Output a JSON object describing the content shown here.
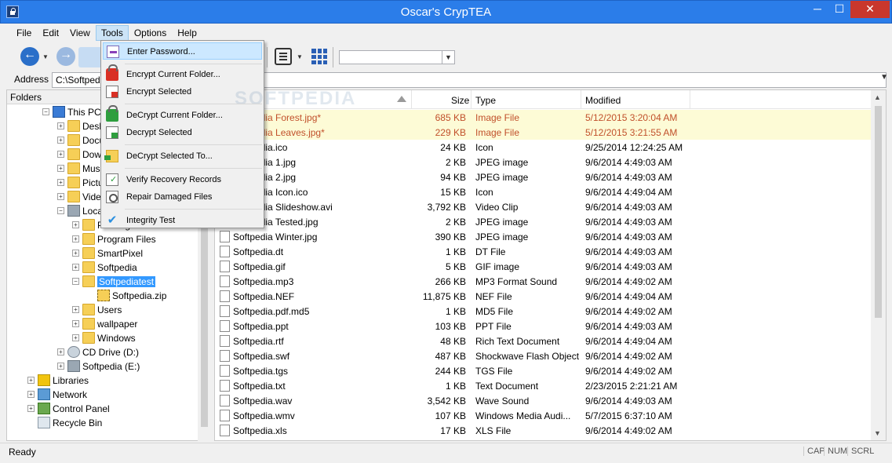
{
  "window": {
    "title": "Oscar's CrypTEA",
    "min": "─",
    "max": "☐",
    "close": "✕"
  },
  "menu": [
    "File",
    "Edit",
    "View",
    "Tools",
    "Options",
    "Help"
  ],
  "address": {
    "label": "Address",
    "value": "C:\\Softpedia"
  },
  "watermark": "SOFTPEDIA",
  "folders": {
    "title": "Folders",
    "items": [
      {
        "label": "This PC",
        "icon": "pc-icon",
        "expander": "−"
      },
      {
        "label": "Desktop",
        "icon": "folder-icon",
        "expander": "+"
      },
      {
        "label": "Documents",
        "icon": "folder-icon",
        "expander": "+"
      },
      {
        "label": "Downloads",
        "icon": "folder-icon",
        "expander": "+"
      },
      {
        "label": "Music",
        "icon": "folder-icon",
        "expander": "+"
      },
      {
        "label": "Pictures",
        "icon": "folder-icon",
        "expander": "+"
      },
      {
        "label": "Videos",
        "icon": "folder-icon",
        "expander": "+"
      },
      {
        "label": "Local Disk (C:)",
        "icon": "drive-icon",
        "expander": "−"
      },
      {
        "label": "PerfLogs",
        "icon": "folder-icon",
        "expander": "+"
      },
      {
        "label": "Program Files",
        "icon": "folder-icon",
        "expander": "+"
      },
      {
        "label": "SmartPixel",
        "icon": "folder-icon",
        "expander": "+"
      },
      {
        "label": "Softpedia",
        "icon": "folder-icon",
        "expander": "+"
      },
      {
        "label": "Softpediatest",
        "icon": "folder-icon",
        "expander": "−"
      },
      {
        "label": "Softpedia.zip",
        "icon": "zip-icon",
        "expander": ""
      },
      {
        "label": "Users",
        "icon": "folder-icon",
        "expander": "+"
      },
      {
        "label": "wallpaper",
        "icon": "folder-icon",
        "expander": "+"
      },
      {
        "label": "Windows",
        "icon": "folder-icon",
        "expander": "+"
      },
      {
        "label": "CD Drive (D:)",
        "icon": "cd-icon",
        "expander": "+"
      },
      {
        "label": "Softpedia (E:)",
        "icon": "drive-icon",
        "expander": "+"
      },
      {
        "label": "Libraries",
        "icon": "library-icon",
        "expander": "+"
      },
      {
        "label": "Network",
        "icon": "network-icon",
        "expander": "+"
      },
      {
        "label": "Control Panel",
        "icon": "control-panel-icon",
        "expander": "+"
      },
      {
        "label": "Recycle Bin",
        "icon": "recycle-bin-icon",
        "expander": ""
      }
    ]
  },
  "files": {
    "columns": {
      "name": "",
      "size": "Size",
      "type": "Type",
      "modified": "Modified"
    },
    "rows": [
      {
        "name": "Softpedia Forest.jpg*",
        "size": "685 KB",
        "type": "Image File",
        "modified": "5/12/2015 3:20:04 AM"
      },
      {
        "name": "Softpedia Leaves.jpg*",
        "size": "229 KB",
        "type": "Image File",
        "modified": "5/12/2015 3:21:55 AM"
      },
      {
        "name": "Softpedia.ico",
        "size": "24 KB",
        "type": "Icon",
        "modified": "9/25/2014 12:24:25 AM"
      },
      {
        "name": "Softpedia 1.jpg",
        "size": "2 KB",
        "type": "JPEG image",
        "modified": "9/6/2014 4:49:03 AM"
      },
      {
        "name": "Softpedia 2.jpg",
        "size": "94 KB",
        "type": "JPEG image",
        "modified": "9/6/2014 4:49:03 AM"
      },
      {
        "name": "Softpedia Icon.ico",
        "size": "15 KB",
        "type": "Icon",
        "modified": "9/6/2014 4:49:04 AM"
      },
      {
        "name": "Softpedia Slideshow.avi",
        "size": "3,792 KB",
        "type": "Video Clip",
        "modified": "9/6/2014 4:49:03 AM"
      },
      {
        "name": "Softpedia Tested.jpg",
        "size": "2 KB",
        "type": "JPEG image",
        "modified": "9/6/2014 4:49:03 AM"
      },
      {
        "name": "Softpedia Winter.jpg",
        "size": "390 KB",
        "type": "JPEG image",
        "modified": "9/6/2014 4:49:03 AM"
      },
      {
        "name": "Softpedia.dt",
        "size": "1 KB",
        "type": "DT File",
        "modified": "9/6/2014 4:49:03 AM"
      },
      {
        "name": "Softpedia.gif",
        "size": "5 KB",
        "type": "GIF image",
        "modified": "9/6/2014 4:49:03 AM"
      },
      {
        "name": "Softpedia.mp3",
        "size": "266 KB",
        "type": "MP3 Format Sound",
        "modified": "9/6/2014 4:49:02 AM"
      },
      {
        "name": "Softpedia.NEF",
        "size": "11,875 KB",
        "type": "NEF File",
        "modified": "9/6/2014 4:49:04 AM"
      },
      {
        "name": "Softpedia.pdf.md5",
        "size": "1 KB",
        "type": "MD5 File",
        "modified": "9/6/2014 4:49:02 AM"
      },
      {
        "name": "Softpedia.ppt",
        "size": "103 KB",
        "type": "PPT File",
        "modified": "9/6/2014 4:49:03 AM"
      },
      {
        "name": "Softpedia.rtf",
        "size": "48 KB",
        "type": "Rich Text Document",
        "modified": "9/6/2014 4:49:04 AM"
      },
      {
        "name": "Softpedia.swf",
        "size": "487 KB",
        "type": "Shockwave Flash Object",
        "modified": "9/6/2014 4:49:02 AM"
      },
      {
        "name": "Softpedia.tgs",
        "size": "244 KB",
        "type": "TGS File",
        "modified": "9/6/2014 4:49:02 AM"
      },
      {
        "name": "Softpedia.txt",
        "size": "1 KB",
        "type": "Text Document",
        "modified": "2/23/2015 2:21:21 AM"
      },
      {
        "name": "Softpedia.wav",
        "size": "3,542 KB",
        "type": "Wave Sound",
        "modified": "9/6/2014 4:49:03 AM"
      },
      {
        "name": "Softpedia.wmv",
        "size": "107 KB",
        "type": "Windows Media Audi...",
        "modified": "5/7/2015 6:37:10 AM"
      },
      {
        "name": "Softpedia.xls",
        "size": "17 KB",
        "type": "XLS File",
        "modified": "9/6/2014 4:49:02 AM"
      }
    ]
  },
  "tools_menu": [
    {
      "label": "Enter Password...",
      "icon": "key-icon"
    },
    {
      "label": "Encrypt Current Folder...",
      "icon": "lock-red-icon"
    },
    {
      "label": "Encrypt Selected",
      "icon": "doc-lock-icon"
    },
    {
      "label": "DeCrypt Current Folder...",
      "icon": "lock-green-icon"
    },
    {
      "label": "Decrypt Selected",
      "icon": "doc-unlock-icon"
    },
    {
      "label": "DeCrypt Selected To...",
      "icon": "folder-out-icon"
    },
    {
      "label": "Verify Recovery Records",
      "icon": "verify-icon"
    },
    {
      "label": "Repair Damaged Files",
      "icon": "repair-icon"
    },
    {
      "label": "Integrity Test",
      "icon": "check-icon",
      "glyph": "✔"
    }
  ],
  "status": {
    "text": "Ready",
    "cap": "CAP",
    "num": "NUM",
    "scrl": "SCRL"
  },
  "colors": {
    "titlebar": "#2b7de9",
    "encrypted_text": "#c1502b",
    "encrypted_row": "#fdfbd6",
    "selection": "#3399ff"
  }
}
